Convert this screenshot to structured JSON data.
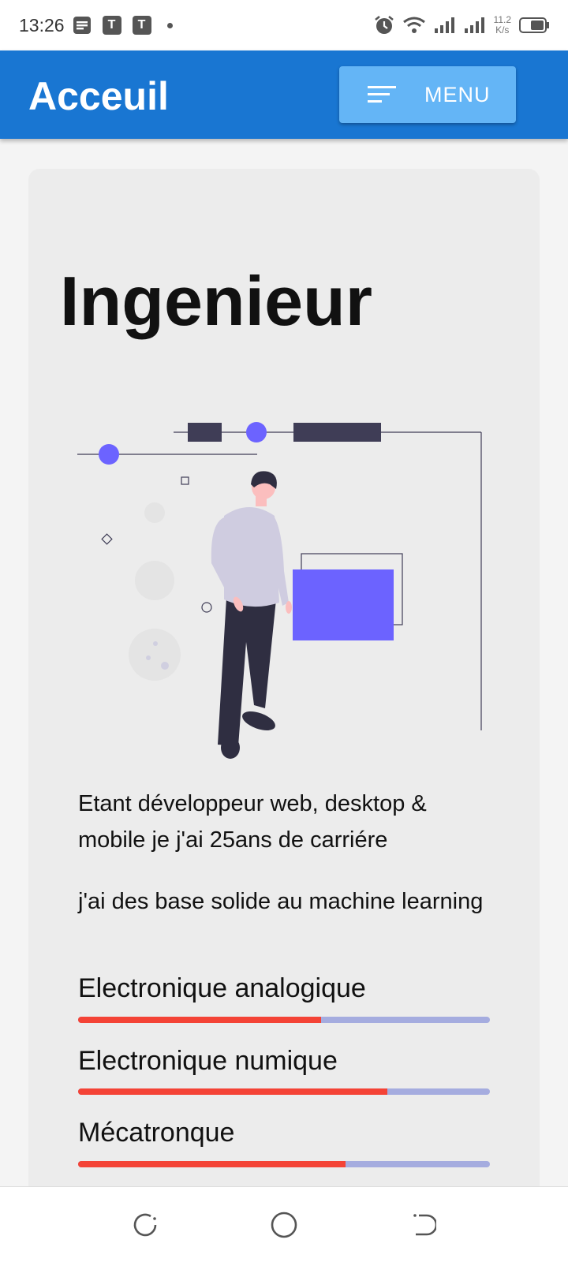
{
  "status_bar": {
    "time": "13:26",
    "icons": [
      "notes-icon",
      "t-app-icon",
      "t-app-icon",
      "dot-icon"
    ],
    "app_icon_letter": "T",
    "speed_value": "11.2",
    "speed_unit": "K/s",
    "right_icons": [
      "alarm-icon",
      "wifi-icon",
      "signal-icon",
      "signal-icon",
      "battery-icon"
    ]
  },
  "app_bar": {
    "title": "Acceuil",
    "menu_label": "MENU",
    "menu_icon": "sort-icon",
    "color": "#1976d2",
    "menu_color": "#64b5f6"
  },
  "card": {
    "title": "Ingenieur",
    "paragraphs": [
      "Etant développeur web, desktop & mobile je j'ai 25ans de carriére",
      "j'ai des base solide au machine learning"
    ],
    "skills": [
      {
        "label": "Electronique analogique",
        "level": 0.59
      },
      {
        "label": "Electronique numique",
        "level": 0.75
      },
      {
        "label": "Mécatronque",
        "level": 0.65
      }
    ],
    "bar_fill_color": "#f44336",
    "bar_track_color": "#a5acdf",
    "accent_color": "#6c63ff"
  },
  "nav_bar": {
    "buttons": [
      "recents-icon",
      "home-icon",
      "back-icon"
    ]
  }
}
